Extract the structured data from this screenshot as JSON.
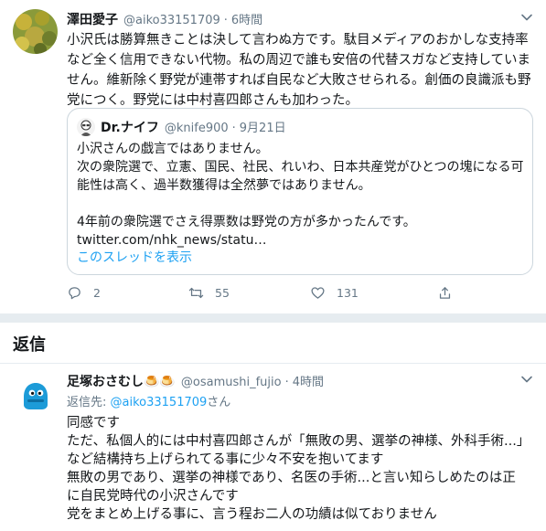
{
  "tweet": {
    "display_name": "澤田愛子",
    "handle": "@aiko33151709",
    "separator": "·",
    "time": "6時間",
    "text": "小沢氏は勝算無きことは決して言わぬ方です。駄目メディアのおかしな支持率など全く信用できない代物。私の周辺で誰も安倍の代替スガなど支持していません。維新除く野党が連帯すれば自民など大敗させられる。創価の良識派も野党につく。野党には中村喜四郎さんも加わった。",
    "quote": {
      "display_name": "Dr.ナイフ",
      "handle": "@knife900",
      "separator": "·",
      "date": "9月21日",
      "lines": [
        "小沢さんの戯言ではありません。",
        "次の衆院選で、立憲、国民、社民、れいわ、日本共産党がひとつの塊になる可能性は高く、過半数獲得は全然夢ではありません。",
        "",
        "4年前の衆院選でさえ得票数は野党の方が多かったんです。",
        "twitter.com/nhk_news/statu…"
      ],
      "thread_link": "このスレッドを表示"
    },
    "actions": {
      "reply_count": "2",
      "retweet_count": "55",
      "like_count": "131"
    }
  },
  "replies_heading": "返信",
  "reply": {
    "display_name": "足塚おさむし🍮🍮",
    "handle": "@osamushi_fujio",
    "separator": "·",
    "time": "4時間",
    "replying_prefix": "返信先: ",
    "replying_mention": "@aiko33151709",
    "replying_suffix": "さん",
    "lines": [
      "同感です",
      "ただ、私個人的には中村喜四郎さんが「無敗の男、選挙の神様、外科手術...」など結構持ち上げられてる事に少々不安を抱いてます",
      "無敗の男であり、選挙の神様であり、名医の手術...と言い知らしめたのは正に自民党時代の小沢さんです",
      "党をまとめ上げる事に、言う程お二人の功績は似ておりません"
    ]
  },
  "colors": {
    "accent": "#1da1f2",
    "secondary_text": "#657786",
    "border": "#ccd6dd",
    "divider": "#e6ecf0"
  },
  "icons": {
    "reply": "reply-icon",
    "retweet": "retweet-icon",
    "like": "heart-icon",
    "share": "share-icon",
    "caret": "chevron-down-icon"
  }
}
